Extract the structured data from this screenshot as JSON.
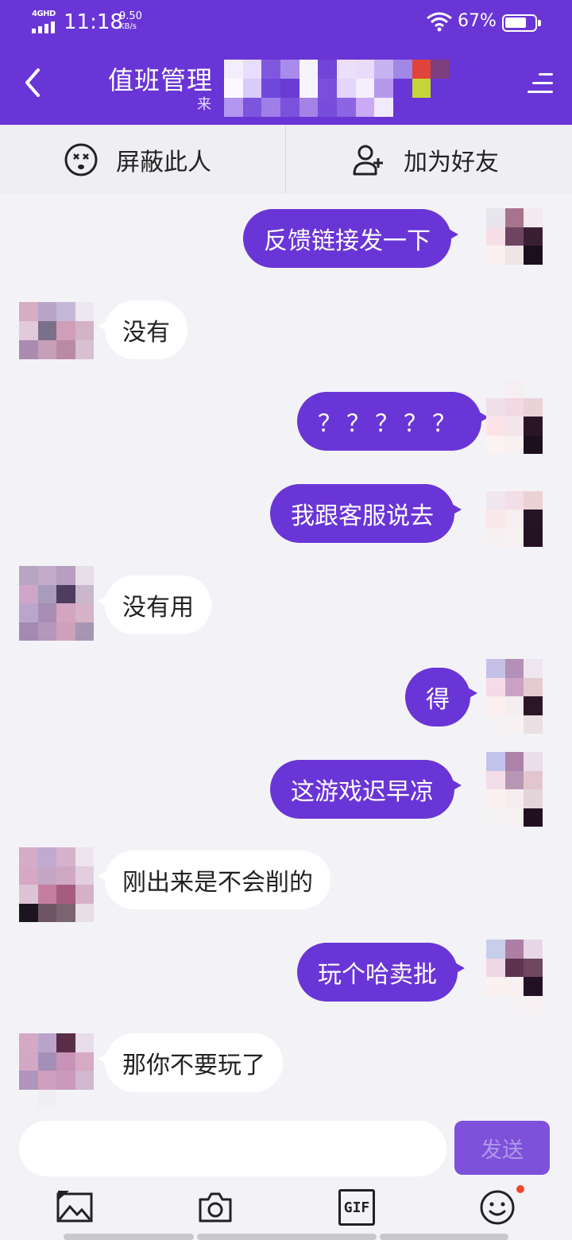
{
  "status_bar": {
    "network": "4GHD",
    "time": "11:18",
    "speed_value": "9.50",
    "speed_unit": "KB/s",
    "battery_percent": "67%"
  },
  "header": {
    "title": "值班管理",
    "subtitle": "来",
    "back_icon": "chevron-left-icon",
    "menu_icon": "menu-icon"
  },
  "actions": {
    "block": {
      "label": "屏蔽此人",
      "icon": "block-face-icon"
    },
    "add_friend": {
      "label": "加为好友",
      "icon": "add-user-icon"
    }
  },
  "messages": [
    {
      "side": "out",
      "text": "反馈链接发一下"
    },
    {
      "side": "in",
      "text": "没有"
    },
    {
      "side": "out",
      "text": "？？？？？"
    },
    {
      "side": "out",
      "text": "我跟客服说去"
    },
    {
      "side": "in",
      "text": "没有用"
    },
    {
      "side": "out",
      "text": "得"
    },
    {
      "side": "out",
      "text": "这游戏迟早凉"
    },
    {
      "side": "in",
      "text": "刚出来是不会削的"
    },
    {
      "side": "out",
      "text": "玩个哈卖批"
    },
    {
      "side": "in",
      "text": "那你不要玩了"
    }
  ],
  "composer": {
    "input_value": "",
    "input_placeholder": "",
    "send_label": "发送"
  },
  "toolbar": {
    "image_icon": "image-icon",
    "camera_icon": "camera-icon",
    "gif_label": "GIF",
    "emoji_icon": "emoji-icon"
  },
  "colors": {
    "brand": "#6a35d6",
    "background": "#f3f3f7",
    "notification_dot": "#f0482e"
  }
}
